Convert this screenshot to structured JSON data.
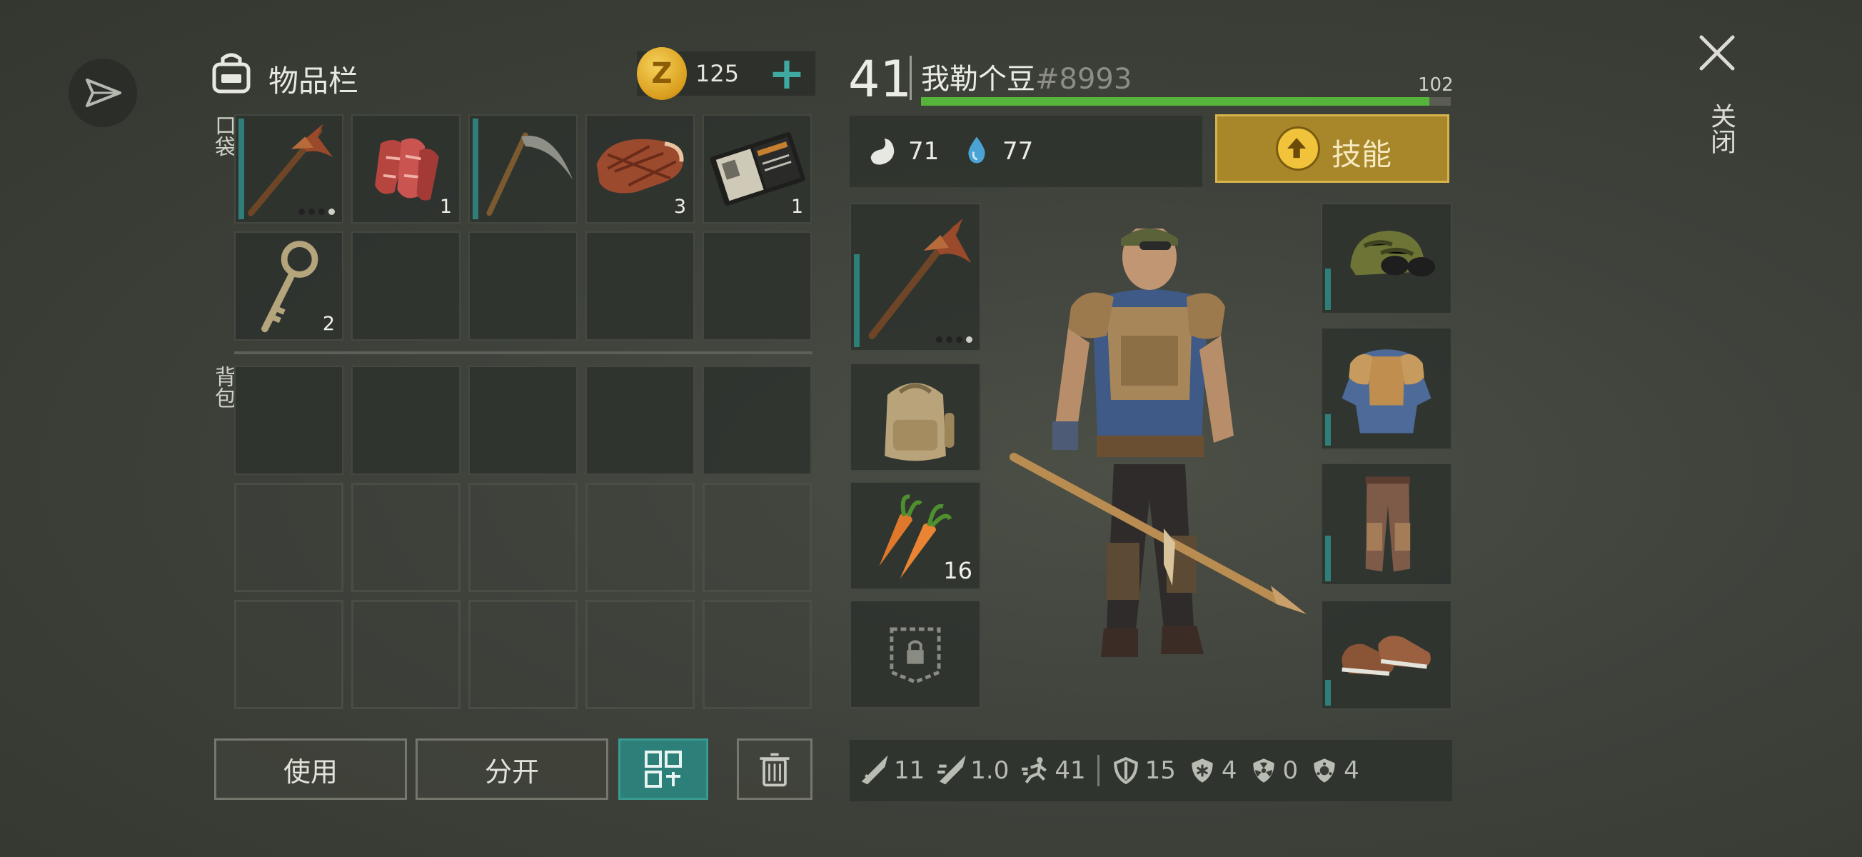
{
  "header": {
    "title": "物品栏",
    "coins": "125",
    "add_symbol": "+"
  },
  "sections": {
    "pockets_label": "口袋",
    "backpack_label": "背包"
  },
  "pocket_items": [
    {
      "name": "pickaxe",
      "count": "",
      "durability_dots": [
        false,
        false,
        false,
        true
      ]
    },
    {
      "name": "raw-meat",
      "count": "1"
    },
    {
      "name": "scythe",
      "count": ""
    },
    {
      "name": "steak",
      "count": "3"
    },
    {
      "name": "id-wallet",
      "count": "1"
    },
    {
      "name": "key",
      "count": "2"
    }
  ],
  "buttons": {
    "use": "使用",
    "split": "分开"
  },
  "player": {
    "level": "41",
    "name": "我勒个豆",
    "tag": "#8993",
    "xp_label": "102",
    "xp_fraction": 0.96
  },
  "vitals": {
    "food": "71",
    "water": "77"
  },
  "skills_button": "技能",
  "equip_left": [
    {
      "name": "pickaxe",
      "count": ""
    },
    {
      "name": "backpack",
      "count": ""
    },
    {
      "name": "carrots",
      "count": "16"
    },
    {
      "name": "locked-pocket",
      "count": ""
    }
  ],
  "stats": {
    "attack": "11",
    "attack_speed": "1.0",
    "movement": "41",
    "defense": "15",
    "cold_resist": "4",
    "radiation": "0",
    "infection": "4"
  },
  "close_label": "关闭",
  "colors": {
    "accent_teal": "#2e7f7a",
    "xp_green": "#56b33b",
    "skills_gold": "#a8862a",
    "coin_gold": "#e3b12c"
  }
}
